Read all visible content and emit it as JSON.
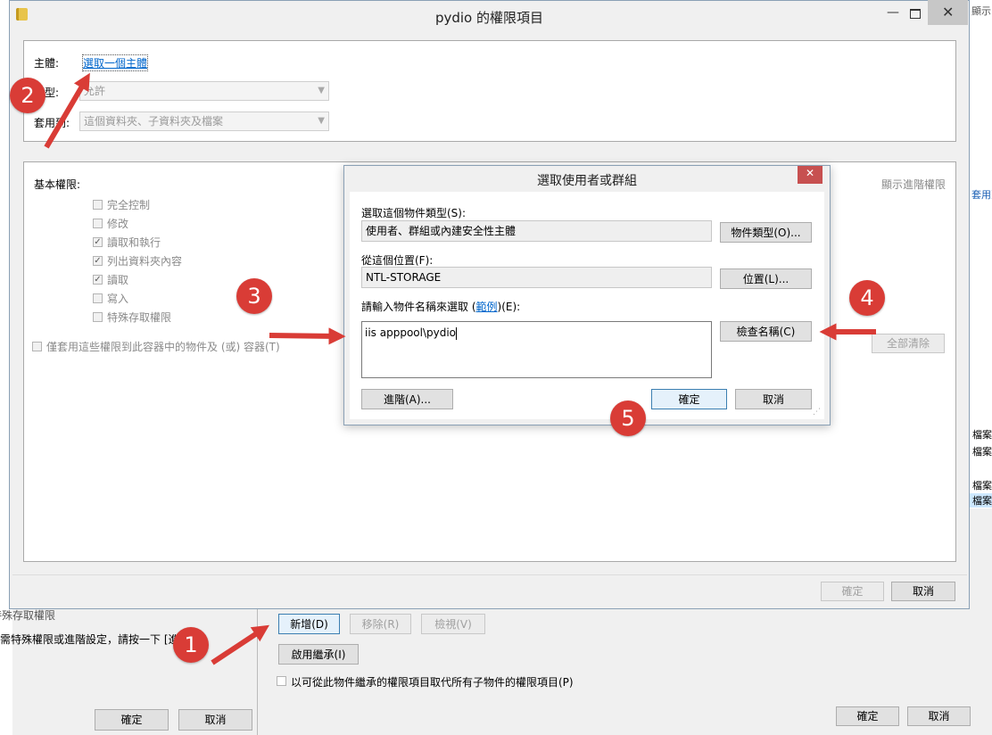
{
  "main_window": {
    "title": "pydio 的權限項目",
    "principal_label": "主體:",
    "principal_link": "選取一個主體",
    "type_label": "類型:",
    "type_value": "允許",
    "applies_label": "套用到:",
    "applies_value": "這個資料夾、子資料夾及檔案",
    "basic_permissions_label": "基本權限:",
    "show_advanced": "顯示進階權限",
    "permissions": [
      {
        "label": "完全控制",
        "checked": false
      },
      {
        "label": "修改",
        "checked": false
      },
      {
        "label": "讀取和執行",
        "checked": true
      },
      {
        "label": "列出資料夾內容",
        "checked": true
      },
      {
        "label": "讀取",
        "checked": true
      },
      {
        "label": "寫入",
        "checked": false
      },
      {
        "label": "特殊存取權限",
        "checked": false
      }
    ],
    "apply_only_label": "僅套用這些權限到此容器中的物件及 (或) 容器(T)",
    "clear_all": "全部清除",
    "ok": "確定",
    "cancel": "取消"
  },
  "select_dialog": {
    "title": "選取使用者或群組",
    "object_type_label": "選取這個物件類型(S):",
    "object_type_value": "使用者、群組或內建安全性主體",
    "object_type_button": "物件類型(O)...",
    "location_label": "從這個位置(F):",
    "location_value": "NTL-STORAGE",
    "location_button": "位置(L)...",
    "enter_names_label": "請輸入物件名稱來選取 (",
    "examples_link": "範例",
    "enter_names_suffix": ")(E):",
    "names_value": "iis apppool\\pydio",
    "check_names_button": "檢查名稱(C)",
    "advanced_button": "進階(A)...",
    "ok": "確定",
    "cancel": "取消"
  },
  "background_window": {
    "add": "新增(D)",
    "remove": "移除(R)",
    "view": "檢視(V)",
    "enable_inheritance": "啟用繼承(I)",
    "replace_label": "以可從此物件繼承的權限項目取代所有子物件的權限項目(P)",
    "ok": "確定",
    "cancel": "取消",
    "left_ok": "確定",
    "left_cancel": "取消",
    "left_text": "需特殊權限或進階設定，請按一下 [進",
    "left_combo": "特殊存取權限",
    "right_header": "顯示",
    "right_fragment": "套用到",
    "right_rows": [
      "檔案",
      "檔案",
      "檔案",
      "檔案"
    ]
  },
  "annotations": [
    "1",
    "2",
    "3",
    "4",
    "5"
  ]
}
